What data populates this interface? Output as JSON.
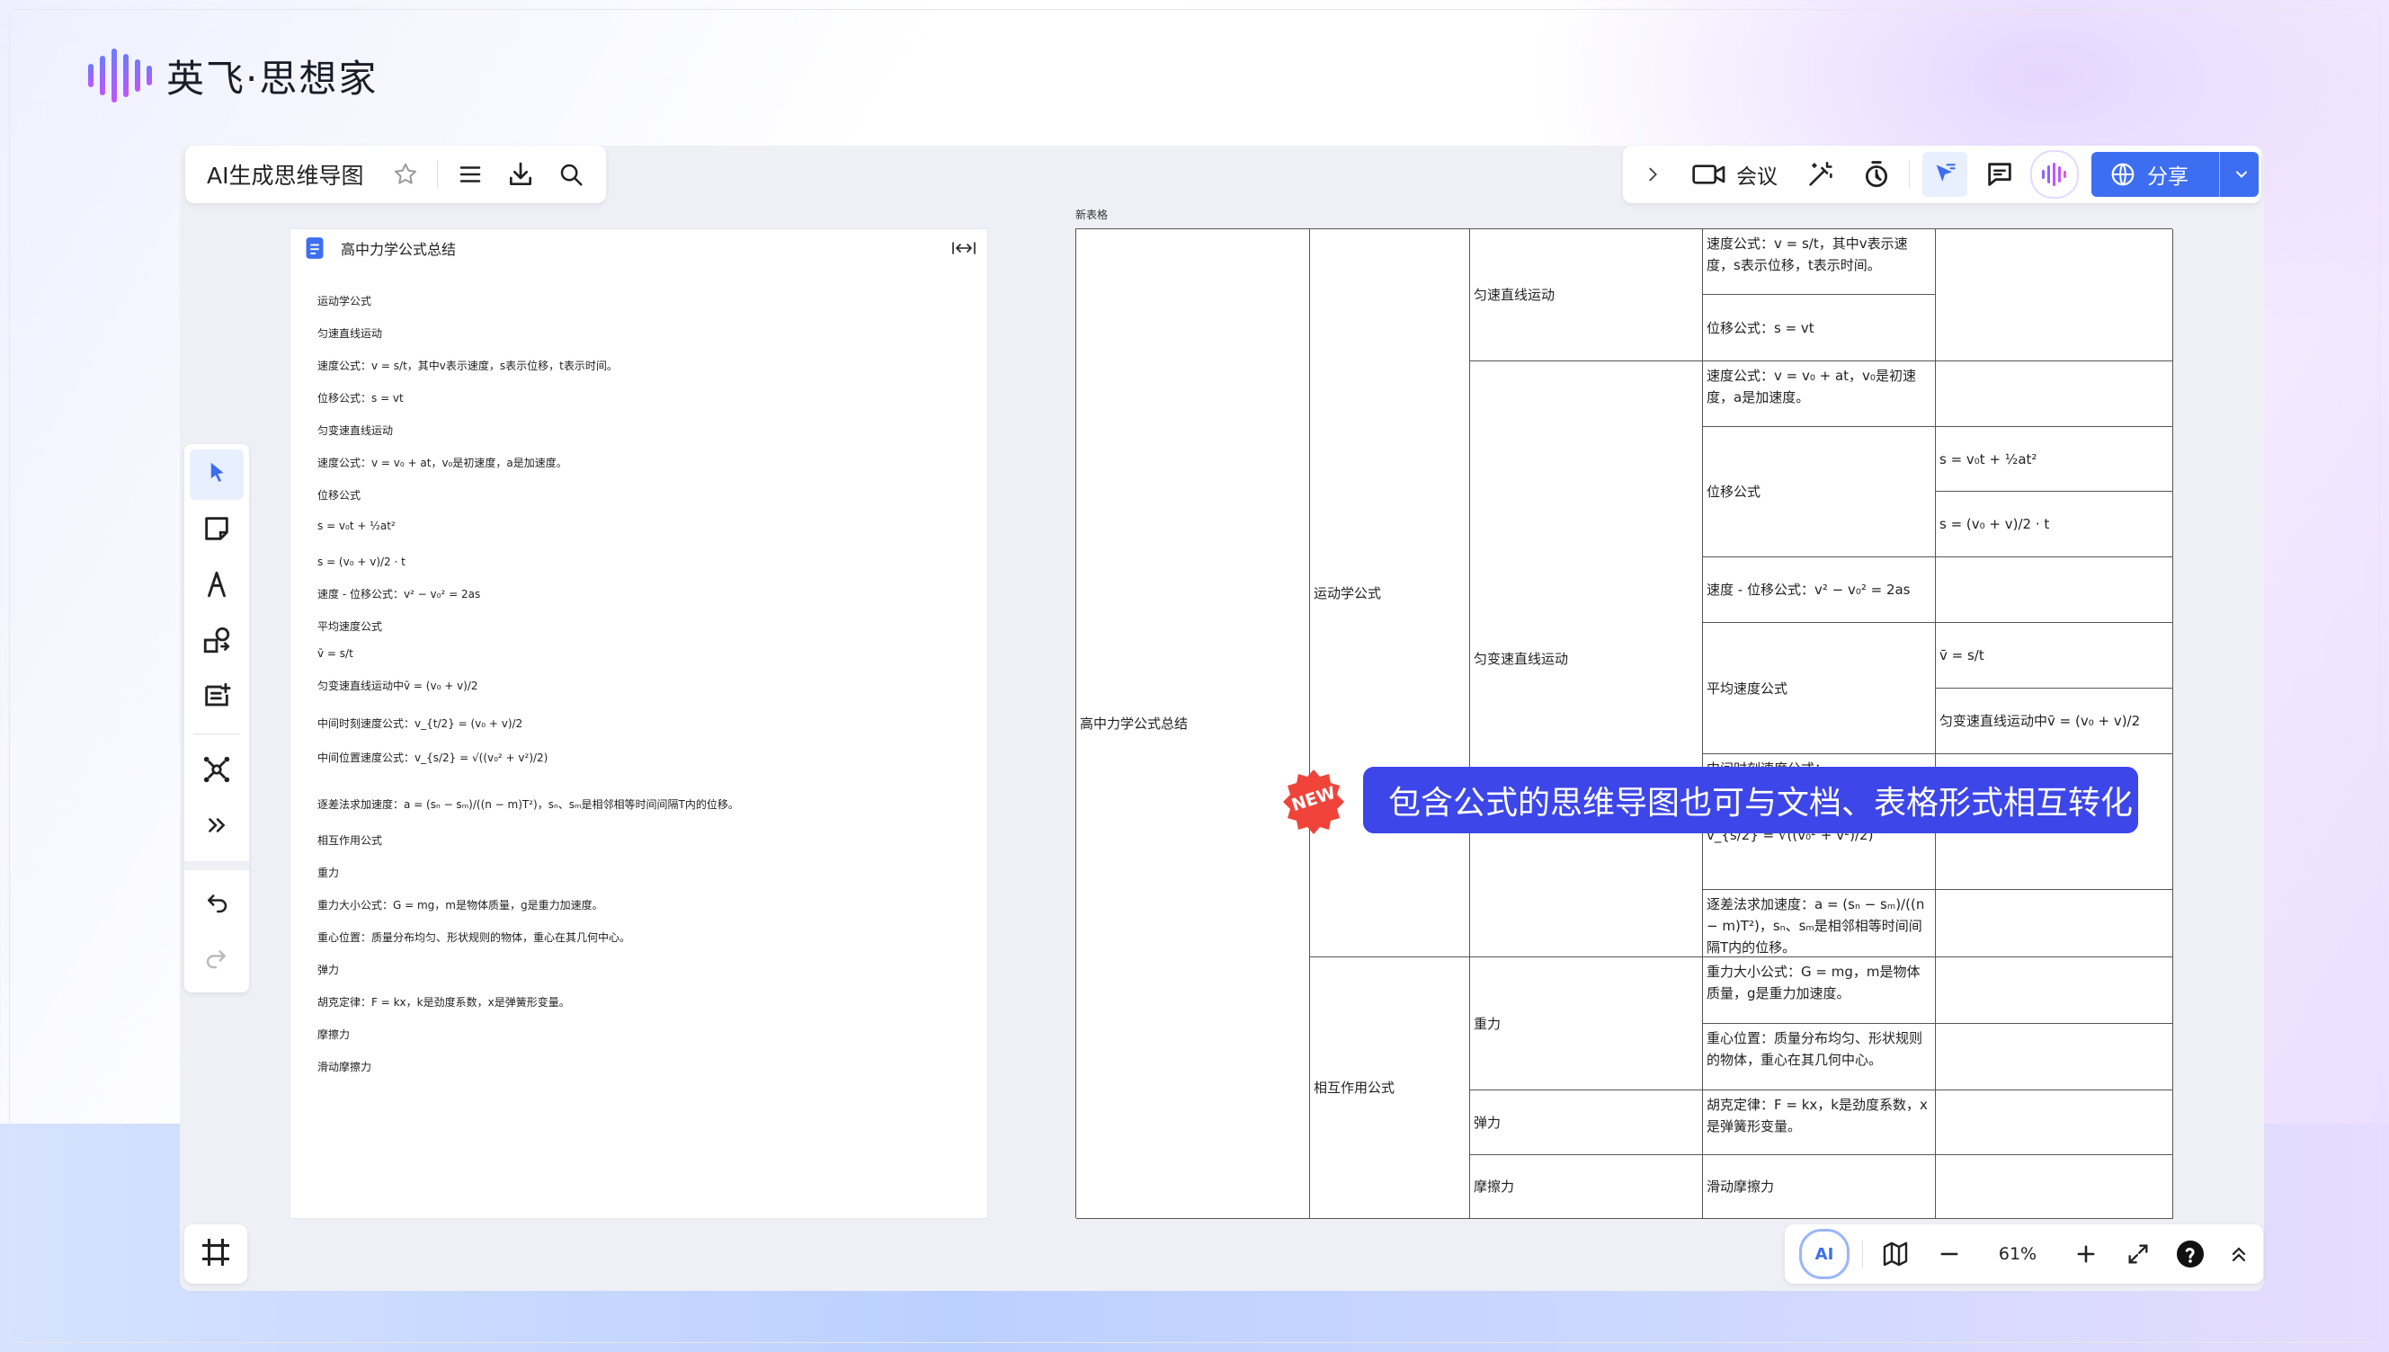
{
  "brand": {
    "name": "英飞·思想家"
  },
  "toolbar_top_left": {
    "title": "AI生成思维导图"
  },
  "toolbar_top_right": {
    "meeting_label": "会议",
    "share_label": "分享"
  },
  "doc": {
    "title": "高中力学公式总结",
    "lines": [
      "运动学公式",
      "匀速直线运动",
      "速度公式：v = s/t，其中v表示速度，s表示位移，t表示时间。",
      "位移公式：s = vt",
      "匀变速直线运动",
      "速度公式：v = v₀ + at，v₀是初速度，a是加速度。",
      "位移公式",
      "s = v₀t + ½at²",
      "s = (v₀ + v)/2 · t",
      "速度 - 位移公式：v² − v₀² = 2as",
      "平均速度公式",
      "v̄ = s/t",
      "匀变速直线运动中v̄ = (v₀ + v)/2",
      "中间时刻速度公式：v_{t/2} = (v₀ + v)/2",
      "中间位置速度公式：v_{s/2} = √((v₀² + v²)/2)",
      "逐差法求加速度：a = (sₙ − sₘ)/((n − m)T²)，sₙ、sₘ是相邻相等时间间隔T内的位移。",
      "相互作用公式",
      "重力",
      "重力大小公式：G = mg，m是物体质量，g是重力加速度。",
      "重心位置：质量分布均匀、形状规则的物体，重心在其几何中心。",
      "弹力",
      "胡克定律：F = kx，k是劲度系数，x是弹簧形变量。",
      "摩擦力",
      "滑动摩擦力"
    ]
  },
  "table": {
    "label": "新表格",
    "root": "高中力学公式总结",
    "l1": [
      "运动学公式",
      "相互作用公式"
    ],
    "l2": [
      "匀速直线运动",
      "匀变速直线运动",
      "重力",
      "弹力",
      "摩擦力"
    ],
    "c": [
      "速度公式：v = s/t，其中v表示速度，s表示位移，t表示时间。",
      "位移公式：s = vt",
      "速度公式：v = v₀ + at，v₀是初速度，a是加速度。",
      "位移公式",
      "速度 - 位移公式：v² − v₀² = 2as",
      "平均速度公式",
      "中间时刻速度公式：",
      "中间位置速度公式：",
      "v_{s/2} = √((v₀² + v²)/2)",
      "逐差法求加速度：a = (sₙ − sₘ)/((n − m)T²)，sₙ、sₘ是相邻相等时间间隔T内的位移。",
      "重力大小公式：G = mg，m是物体质量，g是重力加速度。",
      "重心位置：质量分布均匀、形状规则的物体，重心在其几何中心。",
      "胡克定律：F = kx，k是劲度系数，x是弹簧形变量。",
      "滑动摩擦力"
    ],
    "d": [
      "s = v₀t + ½at²",
      "s = (v₀ + v)/2 · t",
      "v̄ = s/t",
      "匀变速直线运动中v̄ = (v₀ + v)/2"
    ]
  },
  "banner": {
    "text": "包含公式的思维导图也可与文档、表格形式相互转化",
    "badge": "NEW"
  },
  "bottom_bar": {
    "zoom": "61%",
    "ai_label": "AI"
  },
  "colors": {
    "accent": "#3d6ef2",
    "banner": "#3d46e8",
    "badge": "#f0443a"
  }
}
